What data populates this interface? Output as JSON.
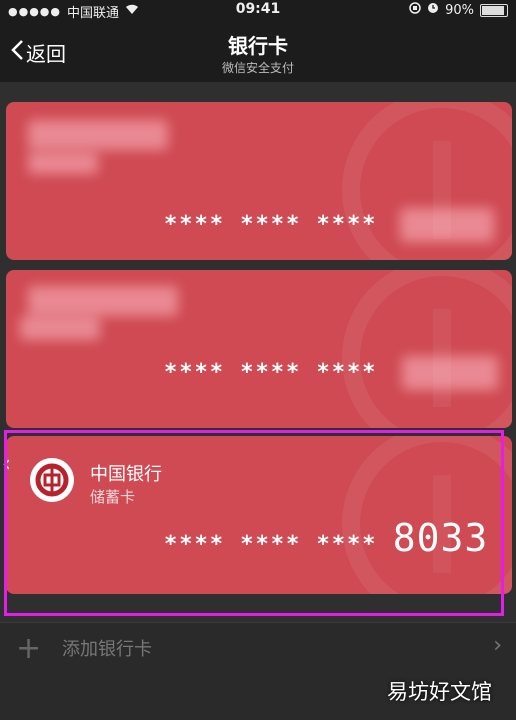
{
  "status_bar": {
    "signal_dots": "●●●●●",
    "carrier": "中国联通",
    "time": "09:41",
    "battery_percent": "90%",
    "battery_level": 0.9
  },
  "nav": {
    "back_label": "返回",
    "title": "银行卡",
    "subtitle": "微信安全支付"
  },
  "cards": [
    {
      "masked_number": "**** **** ****",
      "last4": ""
    },
    {
      "masked_number": "**** **** ****",
      "last4": ""
    },
    {
      "bank_name": "中国银行",
      "card_type": "储蓄卡",
      "masked_number": "**** **** ****",
      "last4": "8033"
    }
  ],
  "add_card": {
    "label": "添加银行卡"
  },
  "watermark": "易坊好文馆",
  "colors": {
    "card_red": "#cf4a52",
    "highlight": "#e21ee8"
  }
}
